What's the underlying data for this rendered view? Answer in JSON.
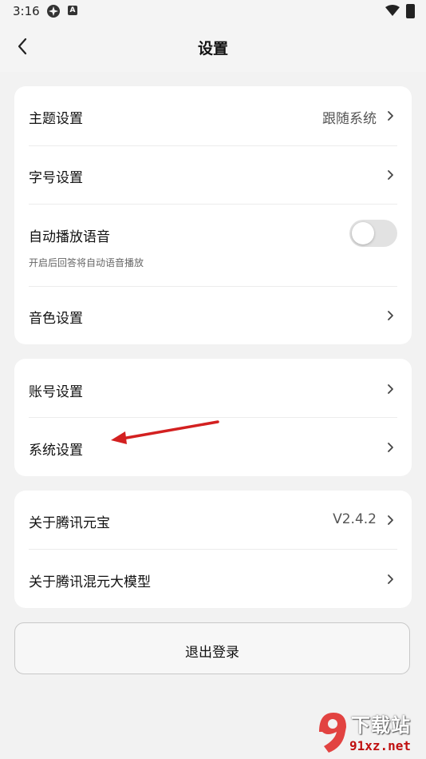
{
  "status_bar": {
    "time": "3:16",
    "app_badge": "A"
  },
  "header": {
    "title": "设置"
  },
  "group1": {
    "theme": {
      "label": "主题设置",
      "value": "跟随系统"
    },
    "font_size": {
      "label": "字号设置"
    },
    "auto_play": {
      "label": "自动播放语音",
      "sub": "开启后回答将自动语音播放",
      "toggle_on": false
    },
    "voice": {
      "label": "音色设置"
    }
  },
  "group2": {
    "account": {
      "label": "账号设置"
    },
    "system": {
      "label": "系统设置"
    }
  },
  "group3": {
    "about_yuanbao": {
      "label": "关于腾讯元宝",
      "value": "V2.4.2"
    },
    "about_hunyuan": {
      "label": "关于腾讯混元大模型"
    }
  },
  "logout": {
    "label": "退出登录"
  },
  "watermark": {
    "title": "下载站",
    "domain": "91xz.net"
  },
  "colors": {
    "annotation_arrow": "#d32020",
    "toggle_off": "#e2e2e2",
    "card": "#ffffff",
    "background": "#f2f2f2"
  }
}
